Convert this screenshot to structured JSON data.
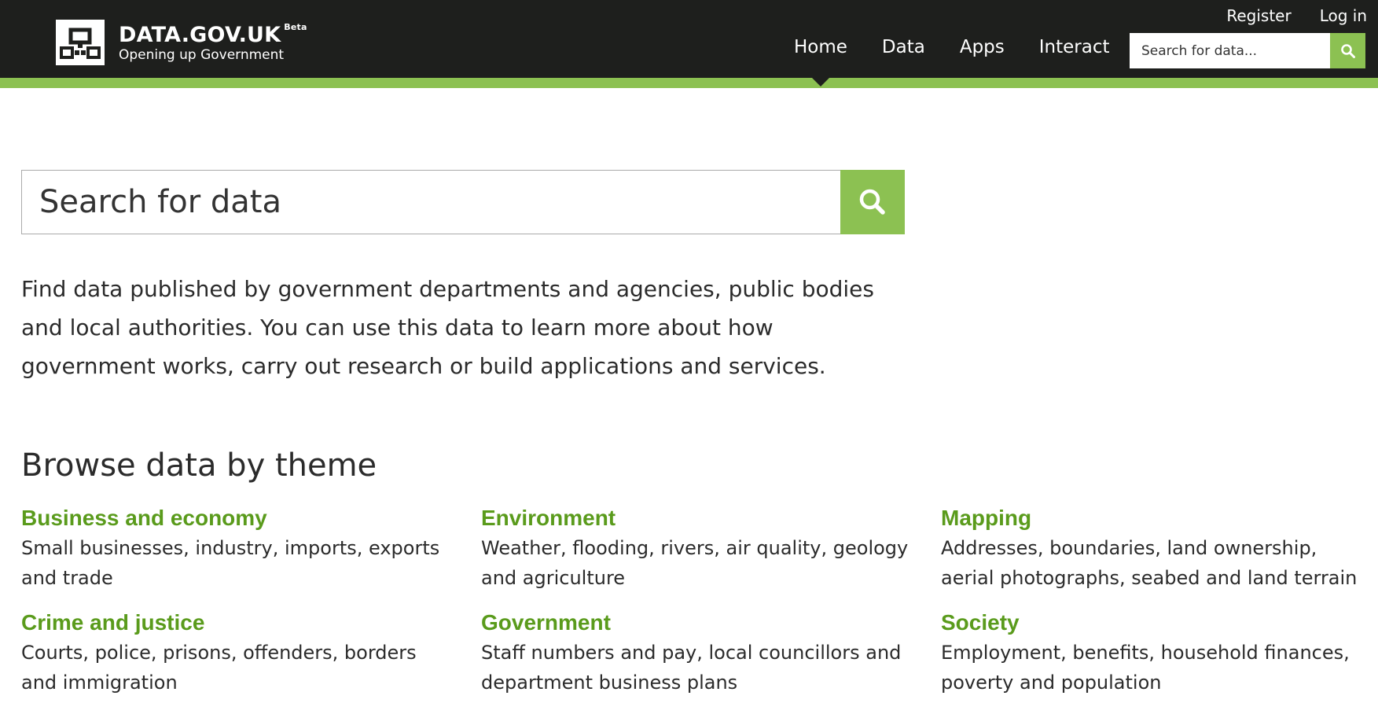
{
  "header": {
    "logo_title": "DATA.GOV.UK",
    "logo_beta": "Beta",
    "logo_subtitle": "Opening up Government",
    "user_links": {
      "register": "Register",
      "login": "Log in"
    },
    "nav": [
      {
        "label": "Home",
        "active": true
      },
      {
        "label": "Data"
      },
      {
        "label": "Apps"
      },
      {
        "label": "Interact"
      }
    ],
    "search_placeholder": "Search for data..."
  },
  "main": {
    "search_placeholder": "Search for data",
    "intro": "Find data published by government departments and agencies, public bodies and local authorities. You can use this data to learn more about how government works, carry out research or build applications and services.",
    "browse_title": "Browse data by theme",
    "themes": [
      {
        "title": "Business and economy",
        "description": "Small businesses, industry, imports, exports and trade"
      },
      {
        "title": "Environment",
        "description": "Weather, flooding, rivers, air quality, geology and agriculture"
      },
      {
        "title": "Mapping",
        "description": "Addresses, boundaries, land ownership, aerial photographs, seabed and land terrain"
      },
      {
        "title": "Crime and justice",
        "description": "Courts, police, prisons, offenders, borders and immigration"
      },
      {
        "title": "Government",
        "description": "Staff numbers and pay, local councillors and department business plans"
      },
      {
        "title": "Society",
        "description": "Employment, benefits, household finances, poverty and population"
      }
    ]
  },
  "icons": {
    "search": "search-icon",
    "logo": "data-gov-logo-icon"
  },
  "colors": {
    "header_bg": "#1e1f1d",
    "accent": "#8cc152",
    "theme_link": "#5a9b1c"
  }
}
